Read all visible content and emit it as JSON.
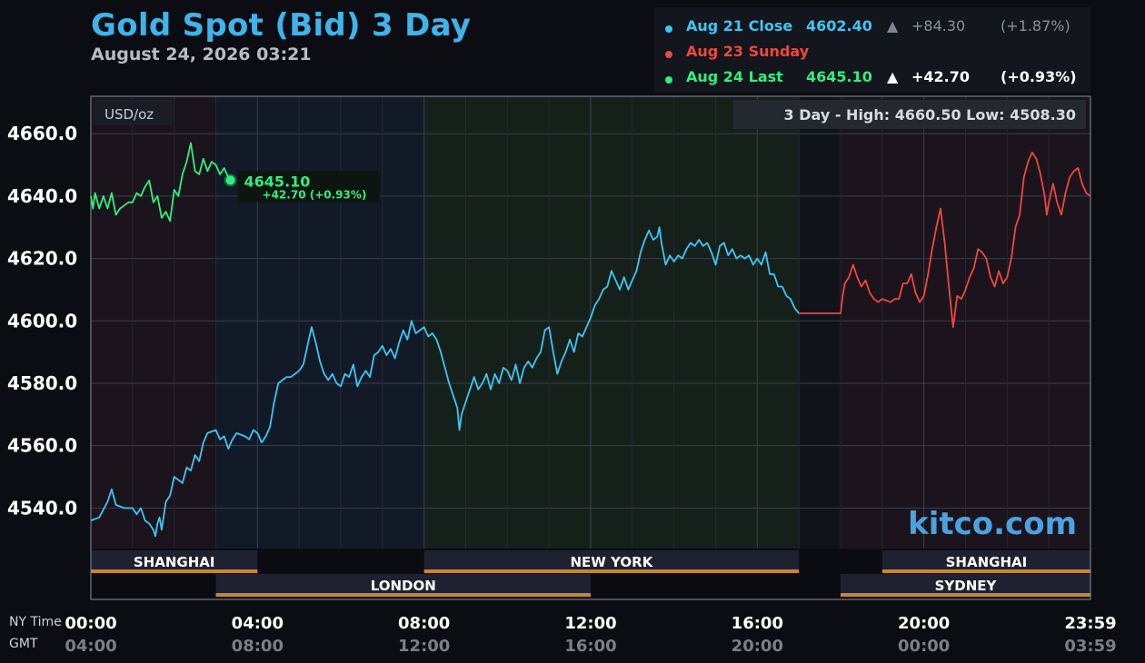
{
  "header": {
    "title": "Gold Spot (Bid) 3 Day",
    "datetime": "August 24, 2026 03:21"
  },
  "legend": [
    {
      "label": "Aug 21 Close",
      "value": "4602.40",
      "arrow": "▲",
      "change": "+84.30",
      "pct": "(+1.87%)",
      "color": "#3ec6f2",
      "muted": true
    },
    {
      "label": "Aug 23 Sunday",
      "value": "",
      "arrow": "",
      "change": "",
      "pct": "",
      "color": "#f0473c",
      "muted": false
    },
    {
      "label": "Aug 24 Last",
      "value": "4645.10",
      "arrow": "▲",
      "change": "+42.70",
      "pct": "(+0.93%)",
      "color": "#2ff07c",
      "muted": false
    }
  ],
  "chart_data": {
    "type": "line",
    "unit_label": "USD/oz",
    "high_low_text": "3 Day - High: 4660.50  Low: 4508.30",
    "ylim": [
      4527,
      4672
    ],
    "yticks": [
      4540,
      4560,
      4580,
      4600,
      4620,
      4640,
      4660
    ],
    "ytick_labels": [
      "4540.0",
      "4560.0",
      "4580.0",
      "4600.0",
      "4620.0",
      "4640.0",
      "4660.0"
    ],
    "xlim": [
      0,
      24
    ],
    "xticks": [
      0,
      4,
      8,
      12,
      16,
      20,
      23.98
    ],
    "x_row_label_ny": "NY Time",
    "x_row_label_gmt": "GMT",
    "xtick_labels_ny": [
      "00:00",
      "04:00",
      "08:00",
      "12:00",
      "16:00",
      "20:00",
      "23:59"
    ],
    "xtick_labels_gmt": [
      "04:00",
      "08:00",
      "12:00",
      "16:00",
      "20:00",
      "00:00",
      "03:59"
    ],
    "last_marker": {
      "x": 3.35,
      "y": 4645.1,
      "price": "4645.10",
      "change": "+42.70 (+0.93%)"
    },
    "watermark": "kitco.com",
    "sessions_top": [
      {
        "name": "SHANGHAI",
        "start": 0,
        "end": 4
      },
      {
        "name": "NEW YORK",
        "start": 8,
        "end": 17
      },
      {
        "name": "SHANGHAI",
        "start": 19,
        "end": 24
      }
    ],
    "sessions_bottom": [
      {
        "name": "LONDON",
        "start": 3,
        "end": 12
      },
      {
        "name": "SYDNEY",
        "start": 18,
        "end": 24
      }
    ],
    "series": [
      {
        "name": "Aug 21 Close",
        "color": "#3ec6f2",
        "points": [
          [
            0,
            4536
          ],
          [
            0.2,
            4537
          ],
          [
            0.4,
            4542
          ],
          [
            0.5,
            4546
          ],
          [
            0.6,
            4541
          ],
          [
            0.8,
            4540
          ],
          [
            1.0,
            4540
          ],
          [
            1.1,
            4538
          ],
          [
            1.2,
            4540
          ],
          [
            1.3,
            4536
          ],
          [
            1.4,
            4535
          ],
          [
            1.5,
            4533
          ],
          [
            1.55,
            4531
          ],
          [
            1.6,
            4535
          ],
          [
            1.65,
            4537
          ],
          [
            1.7,
            4533
          ],
          [
            1.8,
            4542
          ],
          [
            1.9,
            4544
          ],
          [
            2.0,
            4550
          ],
          [
            2.1,
            4549
          ],
          [
            2.2,
            4548
          ],
          [
            2.3,
            4553
          ],
          [
            2.4,
            4552
          ],
          [
            2.5,
            4557
          ],
          [
            2.6,
            4555
          ],
          [
            2.7,
            4561
          ],
          [
            2.8,
            4564
          ],
          [
            3.0,
            4565
          ],
          [
            3.1,
            4562
          ],
          [
            3.2,
            4563
          ],
          [
            3.3,
            4559
          ],
          [
            3.4,
            4562
          ],
          [
            3.5,
            4564
          ],
          [
            3.7,
            4563
          ],
          [
            3.8,
            4562
          ],
          [
            3.9,
            4565
          ],
          [
            4.0,
            4564
          ],
          [
            4.1,
            4561
          ],
          [
            4.2,
            4563
          ],
          [
            4.3,
            4566
          ],
          [
            4.4,
            4574
          ],
          [
            4.5,
            4580
          ],
          [
            4.6,
            4581
          ],
          [
            4.7,
            4582
          ],
          [
            4.8,
            4582
          ],
          [
            4.9,
            4583
          ],
          [
            5.0,
            4584
          ],
          [
            5.1,
            4586
          ],
          [
            5.2,
            4592
          ],
          [
            5.3,
            4598
          ],
          [
            5.4,
            4593
          ],
          [
            5.5,
            4587
          ],
          [
            5.6,
            4583
          ],
          [
            5.7,
            4581
          ],
          [
            5.8,
            4583
          ],
          [
            5.9,
            4580
          ],
          [
            6.0,
            4579
          ],
          [
            6.1,
            4583
          ],
          [
            6.2,
            4582
          ],
          [
            6.3,
            4586
          ],
          [
            6.4,
            4579
          ],
          [
            6.5,
            4582
          ],
          [
            6.6,
            4584
          ],
          [
            6.7,
            4582
          ],
          [
            6.8,
            4589
          ],
          [
            6.9,
            4590
          ],
          [
            7.0,
            4592
          ],
          [
            7.1,
            4589
          ],
          [
            7.2,
            4591
          ],
          [
            7.3,
            4588
          ],
          [
            7.4,
            4593
          ],
          [
            7.5,
            4597
          ],
          [
            7.6,
            4594
          ],
          [
            7.7,
            4600
          ],
          [
            7.8,
            4596
          ],
          [
            7.9,
            4597
          ],
          [
            8.0,
            4598
          ],
          [
            8.1,
            4595
          ],
          [
            8.2,
            4596
          ],
          [
            8.3,
            4594
          ],
          [
            8.4,
            4590
          ],
          [
            8.5,
            4585
          ],
          [
            8.6,
            4580
          ],
          [
            8.7,
            4576
          ],
          [
            8.8,
            4572
          ],
          [
            8.85,
            4565
          ],
          [
            8.9,
            4570
          ],
          [
            9.0,
            4574
          ],
          [
            9.1,
            4578
          ],
          [
            9.2,
            4582
          ],
          [
            9.3,
            4578
          ],
          [
            9.4,
            4580
          ],
          [
            9.5,
            4583
          ],
          [
            9.6,
            4578
          ],
          [
            9.7,
            4583
          ],
          [
            9.8,
            4580
          ],
          [
            9.9,
            4585
          ],
          [
            10.0,
            4584
          ],
          [
            10.1,
            4581
          ],
          [
            10.2,
            4586
          ],
          [
            10.3,
            4580
          ],
          [
            10.4,
            4585
          ],
          [
            10.5,
            4587
          ],
          [
            10.6,
            4585
          ],
          [
            10.7,
            4588
          ],
          [
            10.8,
            4590
          ],
          [
            10.9,
            4597
          ],
          [
            11.0,
            4598
          ],
          [
            11.1,
            4590
          ],
          [
            11.2,
            4583
          ],
          [
            11.3,
            4587
          ],
          [
            11.4,
            4590
          ],
          [
            11.5,
            4594
          ],
          [
            11.6,
            4590
          ],
          [
            11.7,
            4596
          ],
          [
            11.8,
            4595
          ],
          [
            11.9,
            4598
          ],
          [
            12.0,
            4601
          ],
          [
            12.1,
            4605
          ],
          [
            12.2,
            4607
          ],
          [
            12.3,
            4610
          ],
          [
            12.4,
            4611
          ],
          [
            12.5,
            4616
          ],
          [
            12.6,
            4613
          ],
          [
            12.7,
            4610
          ],
          [
            12.8,
            4614
          ],
          [
            12.9,
            4610
          ],
          [
            13.0,
            4613
          ],
          [
            13.1,
            4616
          ],
          [
            13.2,
            4622
          ],
          [
            13.3,
            4626
          ],
          [
            13.4,
            4629
          ],
          [
            13.5,
            4626
          ],
          [
            13.6,
            4627
          ],
          [
            13.65,
            4630
          ],
          [
            13.7,
            4625
          ],
          [
            13.8,
            4618
          ],
          [
            13.9,
            4621
          ],
          [
            14.0,
            4619
          ],
          [
            14.1,
            4621
          ],
          [
            14.2,
            4620
          ],
          [
            14.3,
            4623
          ],
          [
            14.4,
            4625
          ],
          [
            14.5,
            4624
          ],
          [
            14.6,
            4626
          ],
          [
            14.7,
            4624
          ],
          [
            14.8,
            4625
          ],
          [
            14.9,
            4622
          ],
          [
            15.0,
            4618
          ],
          [
            15.1,
            4624
          ],
          [
            15.2,
            4625
          ],
          [
            15.3,
            4621
          ],
          [
            15.4,
            4623
          ],
          [
            15.5,
            4620
          ],
          [
            15.6,
            4621
          ],
          [
            15.7,
            4620
          ],
          [
            15.8,
            4621
          ],
          [
            15.9,
            4618
          ],
          [
            16.0,
            4620
          ],
          [
            16.1,
            4618
          ],
          [
            16.2,
            4622
          ],
          [
            16.3,
            4615
          ],
          [
            16.4,
            4615
          ],
          [
            16.5,
            4611
          ],
          [
            16.6,
            4611
          ],
          [
            16.7,
            4608
          ],
          [
            16.8,
            4607
          ],
          [
            16.9,
            4604
          ],
          [
            17.0,
            4602.4
          ]
        ]
      },
      {
        "name": "Aug 23 Sunday",
        "color": "#f0473c",
        "points": [
          [
            17.0,
            4602.4
          ],
          [
            18.0,
            4602.4
          ],
          [
            18.05,
            4608
          ],
          [
            18.1,
            4612
          ],
          [
            18.2,
            4614
          ],
          [
            18.3,
            4618
          ],
          [
            18.4,
            4614
          ],
          [
            18.5,
            4611
          ],
          [
            18.6,
            4613
          ],
          [
            18.7,
            4609
          ],
          [
            18.8,
            4607
          ],
          [
            18.9,
            4606
          ],
          [
            19.0,
            4607
          ],
          [
            19.2,
            4606
          ],
          [
            19.3,
            4607
          ],
          [
            19.4,
            4607
          ],
          [
            19.5,
            4612
          ],
          [
            19.6,
            4612
          ],
          [
            19.7,
            4615
          ],
          [
            19.8,
            4609
          ],
          [
            19.9,
            4606
          ],
          [
            20.0,
            4608
          ],
          [
            20.1,
            4615
          ],
          [
            20.2,
            4623
          ],
          [
            20.3,
            4630
          ],
          [
            20.4,
            4636
          ],
          [
            20.5,
            4625
          ],
          [
            20.6,
            4611
          ],
          [
            20.7,
            4598
          ],
          [
            20.8,
            4608
          ],
          [
            20.9,
            4607
          ],
          [
            21.0,
            4610
          ],
          [
            21.1,
            4614
          ],
          [
            21.2,
            4617
          ],
          [
            21.3,
            4623
          ],
          [
            21.4,
            4622
          ],
          [
            21.5,
            4620
          ],
          [
            21.6,
            4614
          ],
          [
            21.7,
            4611
          ],
          [
            21.8,
            4616
          ],
          [
            21.9,
            4612
          ],
          [
            22.0,
            4614
          ],
          [
            22.1,
            4620
          ],
          [
            22.2,
            4630
          ],
          [
            22.3,
            4634
          ],
          [
            22.4,
            4646
          ],
          [
            22.5,
            4651
          ],
          [
            22.6,
            4654
          ],
          [
            22.7,
            4652
          ],
          [
            22.8,
            4647
          ],
          [
            22.9,
            4640
          ],
          [
            22.95,
            4634
          ],
          [
            23.0,
            4638
          ],
          [
            23.1,
            4644
          ],
          [
            23.2,
            4638
          ],
          [
            23.3,
            4634
          ],
          [
            23.4,
            4641
          ],
          [
            23.5,
            4646
          ],
          [
            23.6,
            4648
          ],
          [
            23.7,
            4649
          ],
          [
            23.8,
            4644
          ],
          [
            23.9,
            4641
          ],
          [
            24.0,
            4640
          ]
        ]
      },
      {
        "name": "Aug 24 Last",
        "color": "#2ff07c",
        "points": [
          [
            0,
            4640
          ],
          [
            0.05,
            4636
          ],
          [
            0.1,
            4641
          ],
          [
            0.2,
            4636
          ],
          [
            0.3,
            4640
          ],
          [
            0.4,
            4636
          ],
          [
            0.5,
            4641
          ],
          [
            0.6,
            4634
          ],
          [
            0.7,
            4636
          ],
          [
            0.8,
            4637
          ],
          [
            0.9,
            4638
          ],
          [
            1.0,
            4638
          ],
          [
            1.1,
            4641
          ],
          [
            1.2,
            4640
          ],
          [
            1.3,
            4643
          ],
          [
            1.4,
            4645
          ],
          [
            1.5,
            4638
          ],
          [
            1.6,
            4640
          ],
          [
            1.7,
            4633
          ],
          [
            1.8,
            4635
          ],
          [
            1.9,
            4632
          ],
          [
            2.0,
            4642
          ],
          [
            2.1,
            4640
          ],
          [
            2.2,
            4647
          ],
          [
            2.3,
            4651
          ],
          [
            2.4,
            4657
          ],
          [
            2.5,
            4648
          ],
          [
            2.6,
            4647
          ],
          [
            2.7,
            4652
          ],
          [
            2.8,
            4648
          ],
          [
            2.9,
            4651
          ],
          [
            3.0,
            4650
          ],
          [
            3.1,
            4647
          ],
          [
            3.2,
            4649
          ],
          [
            3.3,
            4646
          ],
          [
            3.35,
            4645.1
          ]
        ]
      }
    ]
  }
}
